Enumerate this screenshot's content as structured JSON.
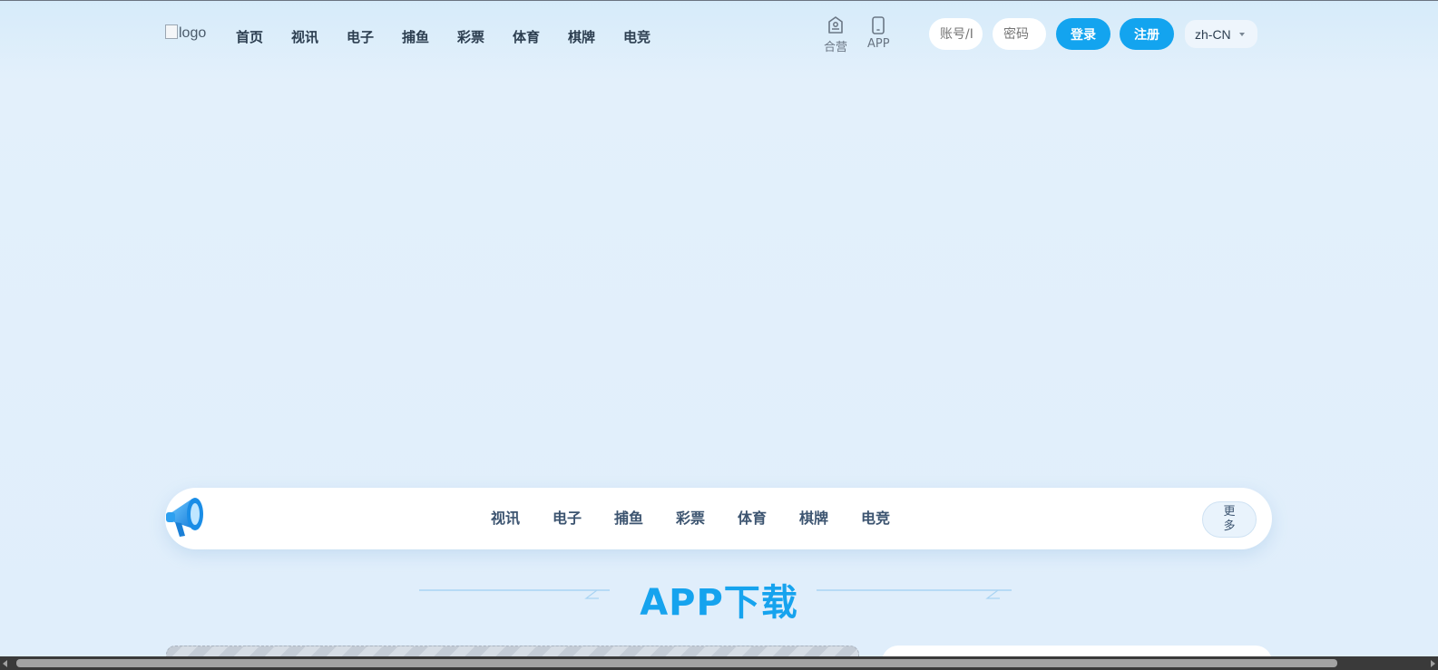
{
  "header": {
    "logo_alt": "logo",
    "nav": [
      "首页",
      "视讯",
      "电子",
      "捕鱼",
      "彩票",
      "体育",
      "棋牌",
      "电竞"
    ],
    "tools": [
      {
        "label": "合营",
        "icon": "tag-icon"
      },
      {
        "label": "APP",
        "icon": "phone-icon"
      }
    ],
    "account_placeholder": "账号/I",
    "password_placeholder": "密码",
    "login_label": "登录",
    "register_label": "注册",
    "language": "zh-CN"
  },
  "notice": {
    "icon": "megaphone-icon",
    "links": [
      "视讯",
      "电子",
      "捕鱼",
      "彩票",
      "体育",
      "棋牌",
      "电竞"
    ],
    "more_label": "更多"
  },
  "section": {
    "title": "APP下载"
  },
  "colors": {
    "accent": "#13a4ef",
    "background": "#e0eefb",
    "nav_text": "#2c3e50"
  }
}
